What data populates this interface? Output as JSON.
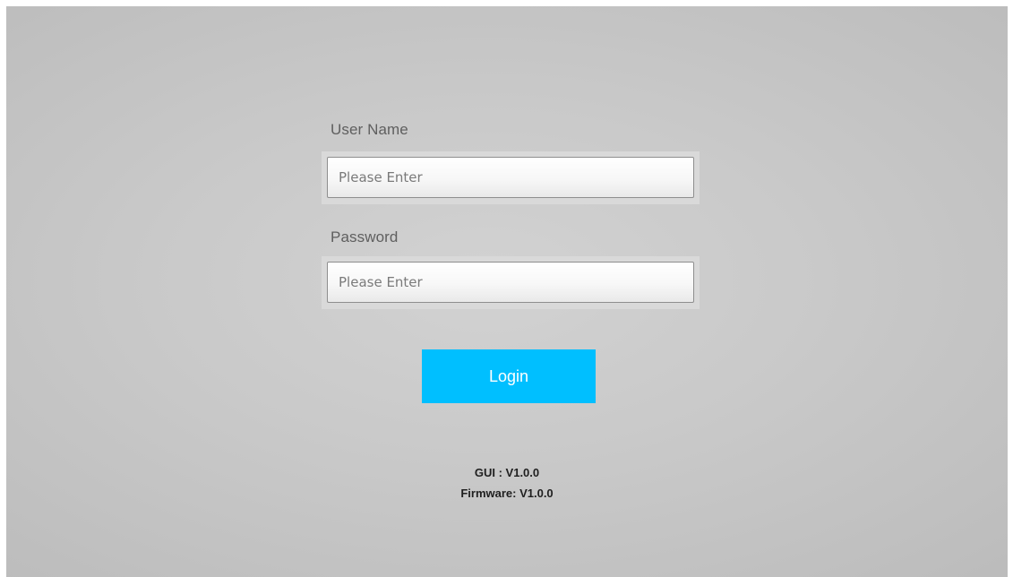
{
  "login_form": {
    "username": {
      "label": "User Name",
      "value": "",
      "placeholder": "Please Enter"
    },
    "password": {
      "label": "Password",
      "value": "",
      "placeholder": "Please Enter"
    },
    "login_label": "Login"
  },
  "version_info": {
    "gui": "GUI : V1.0.0",
    "firmware": "Firmware: V1.0.0"
  },
  "colors": {
    "accent": "#00bfff",
    "background": "#c9c9c9"
  }
}
